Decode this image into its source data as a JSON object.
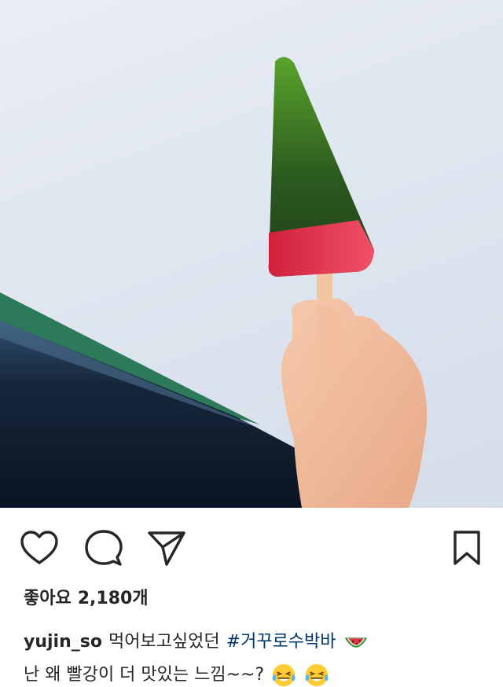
{
  "post": {
    "image": {
      "subject": "hand holding watermelon popsicle"
    },
    "actions": {
      "like_icon": "heart-outline-icon",
      "comment_icon": "comment-bubble-icon",
      "share_icon": "paper-plane-icon",
      "save_icon": "bookmark-outline-icon"
    },
    "likes": {
      "label": "좋아요",
      "count": "2,180개"
    },
    "caption": {
      "username": "yujin_so",
      "text_line1": "먹어보고싶었던",
      "hashtag": "#거꾸로수박바",
      "line1_emoji": "watermelon-emoji",
      "text_line2": "난 왜 빨강이 더 맛있는 느낌~~?",
      "line2_emojis": [
        "laughing-tears-emoji",
        "laughing-tears-emoji"
      ]
    }
  },
  "colors": {
    "text": "#262626",
    "hashtag": "#003569",
    "background": "#ffffff"
  }
}
